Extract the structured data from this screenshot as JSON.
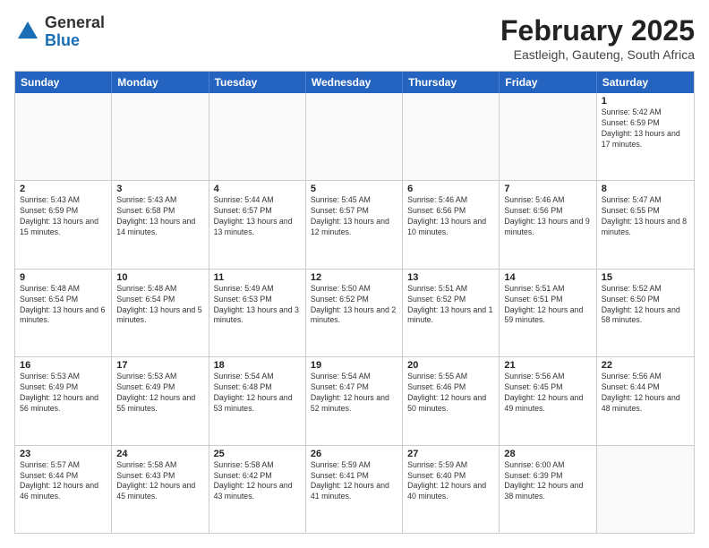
{
  "logo": {
    "general": "General",
    "blue": "Blue"
  },
  "title": "February 2025",
  "location": "Eastleigh, Gauteng, South Africa",
  "header_days": [
    "Sunday",
    "Monday",
    "Tuesday",
    "Wednesday",
    "Thursday",
    "Friday",
    "Saturday"
  ],
  "weeks": [
    [
      {
        "day": "",
        "info": ""
      },
      {
        "day": "",
        "info": ""
      },
      {
        "day": "",
        "info": ""
      },
      {
        "day": "",
        "info": ""
      },
      {
        "day": "",
        "info": ""
      },
      {
        "day": "",
        "info": ""
      },
      {
        "day": "1",
        "info": "Sunrise: 5:42 AM\nSunset: 6:59 PM\nDaylight: 13 hours\nand 17 minutes."
      }
    ],
    [
      {
        "day": "2",
        "info": "Sunrise: 5:43 AM\nSunset: 6:59 PM\nDaylight: 13 hours\nand 15 minutes."
      },
      {
        "day": "3",
        "info": "Sunrise: 5:43 AM\nSunset: 6:58 PM\nDaylight: 13 hours\nand 14 minutes."
      },
      {
        "day": "4",
        "info": "Sunrise: 5:44 AM\nSunset: 6:57 PM\nDaylight: 13 hours\nand 13 minutes."
      },
      {
        "day": "5",
        "info": "Sunrise: 5:45 AM\nSunset: 6:57 PM\nDaylight: 13 hours\nand 12 minutes."
      },
      {
        "day": "6",
        "info": "Sunrise: 5:46 AM\nSunset: 6:56 PM\nDaylight: 13 hours\nand 10 minutes."
      },
      {
        "day": "7",
        "info": "Sunrise: 5:46 AM\nSunset: 6:56 PM\nDaylight: 13 hours\nand 9 minutes."
      },
      {
        "day": "8",
        "info": "Sunrise: 5:47 AM\nSunset: 6:55 PM\nDaylight: 13 hours\nand 8 minutes."
      }
    ],
    [
      {
        "day": "9",
        "info": "Sunrise: 5:48 AM\nSunset: 6:54 PM\nDaylight: 13 hours\nand 6 minutes."
      },
      {
        "day": "10",
        "info": "Sunrise: 5:48 AM\nSunset: 6:54 PM\nDaylight: 13 hours\nand 5 minutes."
      },
      {
        "day": "11",
        "info": "Sunrise: 5:49 AM\nSunset: 6:53 PM\nDaylight: 13 hours\nand 3 minutes."
      },
      {
        "day": "12",
        "info": "Sunrise: 5:50 AM\nSunset: 6:52 PM\nDaylight: 13 hours\nand 2 minutes."
      },
      {
        "day": "13",
        "info": "Sunrise: 5:51 AM\nSunset: 6:52 PM\nDaylight: 13 hours\nand 1 minute."
      },
      {
        "day": "14",
        "info": "Sunrise: 5:51 AM\nSunset: 6:51 PM\nDaylight: 12 hours\nand 59 minutes."
      },
      {
        "day": "15",
        "info": "Sunrise: 5:52 AM\nSunset: 6:50 PM\nDaylight: 12 hours\nand 58 minutes."
      }
    ],
    [
      {
        "day": "16",
        "info": "Sunrise: 5:53 AM\nSunset: 6:49 PM\nDaylight: 12 hours\nand 56 minutes."
      },
      {
        "day": "17",
        "info": "Sunrise: 5:53 AM\nSunset: 6:49 PM\nDaylight: 12 hours\nand 55 minutes."
      },
      {
        "day": "18",
        "info": "Sunrise: 5:54 AM\nSunset: 6:48 PM\nDaylight: 12 hours\nand 53 minutes."
      },
      {
        "day": "19",
        "info": "Sunrise: 5:54 AM\nSunset: 6:47 PM\nDaylight: 12 hours\nand 52 minutes."
      },
      {
        "day": "20",
        "info": "Sunrise: 5:55 AM\nSunset: 6:46 PM\nDaylight: 12 hours\nand 50 minutes."
      },
      {
        "day": "21",
        "info": "Sunrise: 5:56 AM\nSunset: 6:45 PM\nDaylight: 12 hours\nand 49 minutes."
      },
      {
        "day": "22",
        "info": "Sunrise: 5:56 AM\nSunset: 6:44 PM\nDaylight: 12 hours\nand 48 minutes."
      }
    ],
    [
      {
        "day": "23",
        "info": "Sunrise: 5:57 AM\nSunset: 6:44 PM\nDaylight: 12 hours\nand 46 minutes."
      },
      {
        "day": "24",
        "info": "Sunrise: 5:58 AM\nSunset: 6:43 PM\nDaylight: 12 hours\nand 45 minutes."
      },
      {
        "day": "25",
        "info": "Sunrise: 5:58 AM\nSunset: 6:42 PM\nDaylight: 12 hours\nand 43 minutes."
      },
      {
        "day": "26",
        "info": "Sunrise: 5:59 AM\nSunset: 6:41 PM\nDaylight: 12 hours\nand 41 minutes."
      },
      {
        "day": "27",
        "info": "Sunrise: 5:59 AM\nSunset: 6:40 PM\nDaylight: 12 hours\nand 40 minutes."
      },
      {
        "day": "28",
        "info": "Sunrise: 6:00 AM\nSunset: 6:39 PM\nDaylight: 12 hours\nand 38 minutes."
      },
      {
        "day": "",
        "info": ""
      }
    ]
  ]
}
